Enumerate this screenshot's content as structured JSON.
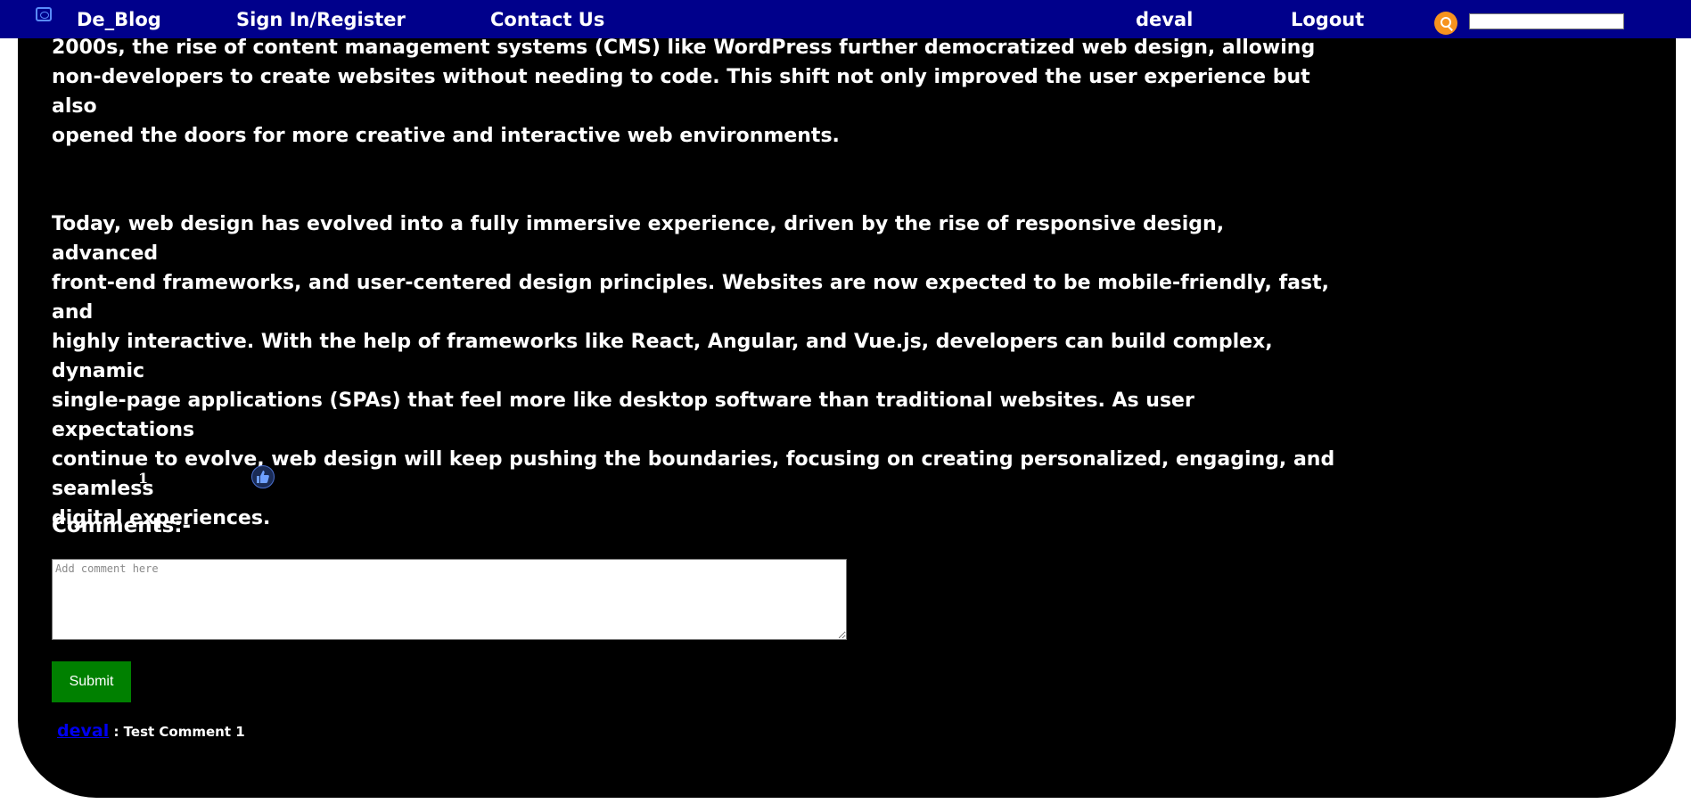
{
  "nav": {
    "brand": "De_Blog",
    "signin": "Sign In/Register",
    "contact": "Contact Us",
    "user": "deval",
    "logout": "Logout",
    "search_value": ""
  },
  "article": {
    "para1_lines": [
      "2000s, the rise of content management systems (CMS) like WordPress further democratized web design, allowing",
      "non-developers to create websites without needing to code. This shift not only improved the user experience but also",
      "opened the doors for more creative and interactive web environments."
    ],
    "para2_lines": [
      "Today, web design has evolved into a fully immersive experience, driven by the rise of responsive design, advanced",
      "front-end frameworks, and user-centered design principles. Websites are now expected to be mobile-friendly, fast, and",
      "highly interactive. With the help of frameworks like React, Angular, and Vue.js, developers can build complex, dynamic",
      "single-page applications (SPAs) that feel more like desktop software than traditional websites. As user expectations",
      "continue to evolve, web design will keep pushing the boundaries, focusing on creating personalized, engaging, and seamless",
      "digital experiences."
    ]
  },
  "likes": {
    "count": "1",
    "icon": "thumbs-up-icon"
  },
  "comments": {
    "heading": "Comments:-",
    "placeholder": "Add comment here",
    "submit_label": "Submit",
    "list": [
      {
        "author": "deval",
        "separator": " : ",
        "text": "Test Comment 1"
      }
    ]
  },
  "colors": {
    "navbar": "#00008b",
    "background": "#000000",
    "submit": "#008000",
    "search_button": "#f7931e",
    "link": "#0000ee"
  }
}
